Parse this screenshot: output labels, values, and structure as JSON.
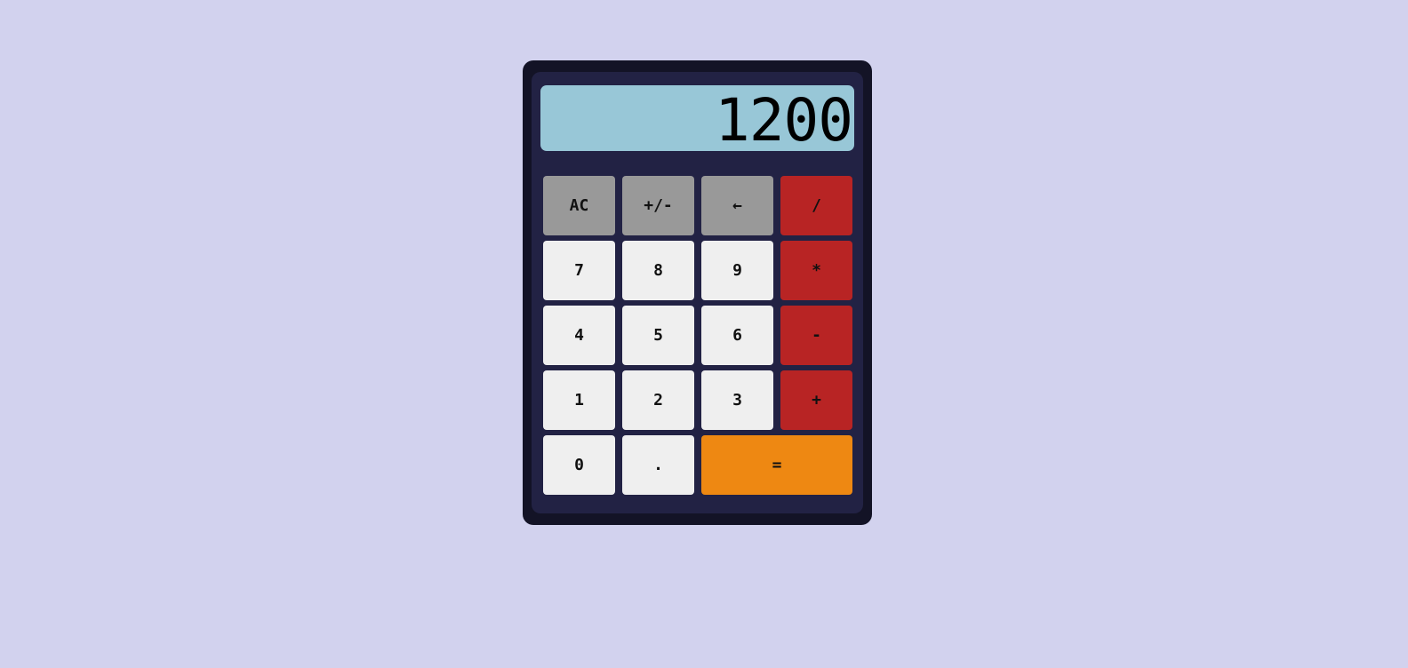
{
  "display": {
    "value": "1200"
  },
  "colors": {
    "background": "#d2d2ee",
    "shell": "#131326",
    "body": "#222244",
    "display": "#98c7d7",
    "number_key": "#efefef",
    "function_key": "#999999",
    "operator_key": "#b82424",
    "equals_key": "#ee8812"
  },
  "keys": {
    "clear": "AC",
    "sign": "+/-",
    "backspace": "←",
    "divide": "/",
    "seven": "7",
    "eight": "8",
    "nine": "9",
    "multiply": "*",
    "four": "4",
    "five": "5",
    "six": "6",
    "subtract": "-",
    "one": "1",
    "two": "2",
    "three": "3",
    "add": "+",
    "zero": "0",
    "decimal": ".",
    "equals": "="
  }
}
